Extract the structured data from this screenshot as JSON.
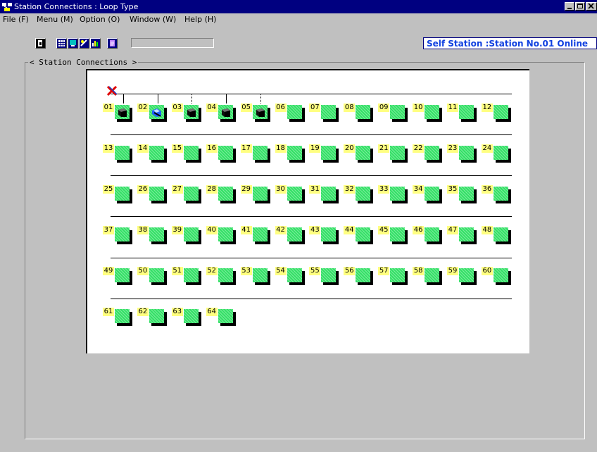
{
  "window": {
    "title": "Station Connections : Loop Type",
    "controls": [
      "minimize",
      "maximize",
      "close"
    ]
  },
  "menubar": {
    "items": [
      "File (F)",
      "Menu (M)",
      "Option (O)",
      "Window (W)",
      "Help (H)"
    ]
  },
  "toolbar": {
    "buttons": [
      "exit-icon",
      "grid-icon",
      "monitor-icon",
      "diagnostic-icon",
      "chart-icon",
      "report-icon"
    ]
  },
  "status": {
    "text": "Self Station :Station No.01  Online"
  },
  "group": {
    "label": "< Station Connections >"
  },
  "stations": [
    {
      "no": "01",
      "device": "plc"
    },
    {
      "no": "02",
      "device": "blue"
    },
    {
      "no": "03",
      "device": "plc"
    },
    {
      "no": "04",
      "device": "plc"
    },
    {
      "no": "05",
      "device": "plc"
    },
    {
      "no": "06",
      "device": ""
    },
    {
      "no": "07",
      "device": ""
    },
    {
      "no": "08",
      "device": ""
    },
    {
      "no": "09",
      "device": ""
    },
    {
      "no": "10",
      "device": ""
    },
    {
      "no": "11",
      "device": ""
    },
    {
      "no": "12",
      "device": ""
    },
    {
      "no": "13",
      "device": ""
    },
    {
      "no": "14",
      "device": ""
    },
    {
      "no": "15",
      "device": ""
    },
    {
      "no": "16",
      "device": ""
    },
    {
      "no": "17",
      "device": ""
    },
    {
      "no": "18",
      "device": ""
    },
    {
      "no": "19",
      "device": ""
    },
    {
      "no": "20",
      "device": ""
    },
    {
      "no": "21",
      "device": ""
    },
    {
      "no": "22",
      "device": ""
    },
    {
      "no": "23",
      "device": ""
    },
    {
      "no": "24",
      "device": ""
    },
    {
      "no": "25",
      "device": ""
    },
    {
      "no": "26",
      "device": ""
    },
    {
      "no": "27",
      "device": ""
    },
    {
      "no": "28",
      "device": ""
    },
    {
      "no": "29",
      "device": ""
    },
    {
      "no": "30",
      "device": ""
    },
    {
      "no": "31",
      "device": ""
    },
    {
      "no": "32",
      "device": ""
    },
    {
      "no": "33",
      "device": ""
    },
    {
      "no": "34",
      "device": ""
    },
    {
      "no": "35",
      "device": ""
    },
    {
      "no": "36",
      "device": ""
    },
    {
      "no": "37",
      "device": ""
    },
    {
      "no": "38",
      "device": ""
    },
    {
      "no": "39",
      "device": ""
    },
    {
      "no": "40",
      "device": ""
    },
    {
      "no": "41",
      "device": ""
    },
    {
      "no": "42",
      "device": ""
    },
    {
      "no": "43",
      "device": ""
    },
    {
      "no": "44",
      "device": ""
    },
    {
      "no": "45",
      "device": ""
    },
    {
      "no": "46",
      "device": ""
    },
    {
      "no": "47",
      "device": ""
    },
    {
      "no": "48",
      "device": ""
    },
    {
      "no": "49",
      "device": ""
    },
    {
      "no": "50",
      "device": ""
    },
    {
      "no": "51",
      "device": ""
    },
    {
      "no": "52",
      "device": ""
    },
    {
      "no": "53",
      "device": ""
    },
    {
      "no": "54",
      "device": ""
    },
    {
      "no": "55",
      "device": ""
    },
    {
      "no": "56",
      "device": ""
    },
    {
      "no": "57",
      "device": ""
    },
    {
      "no": "58",
      "device": ""
    },
    {
      "no": "59",
      "device": ""
    },
    {
      "no": "60",
      "device": ""
    },
    {
      "no": "61",
      "device": ""
    },
    {
      "no": "62",
      "device": ""
    },
    {
      "no": "63",
      "device": ""
    },
    {
      "no": "64",
      "device": ""
    }
  ],
  "colors": {
    "title_bar": "#000080",
    "station_fill": "#33e066",
    "station_number_bg": "#ffff80",
    "status_text": "#1040e0",
    "error_mark": "#e00000"
  }
}
